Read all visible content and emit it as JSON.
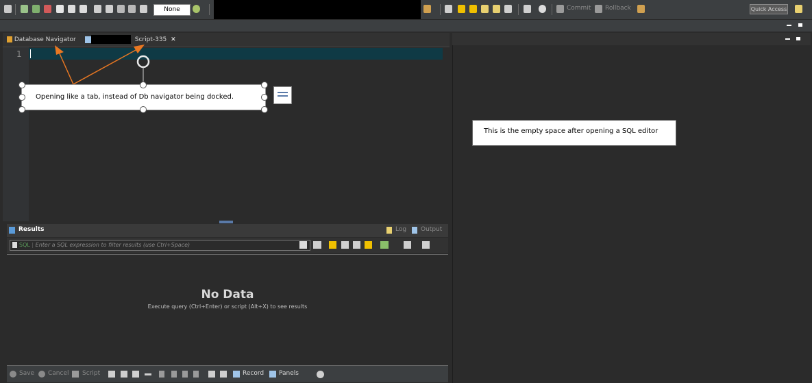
{
  "toolbar": {
    "transaction_mode": "None",
    "commit_label": "Commit",
    "rollback_label": "Rollback",
    "quick_access_label": "Quick Access"
  },
  "editor_tabs": [
    {
      "label": "Database Navigator"
    },
    {
      "label": "Script-335"
    }
  ],
  "editor": {
    "line_number": "1"
  },
  "annotations": {
    "left_note": "Opening like a tab, instead of Db navigator being docked.",
    "right_note": "This is the empty space after opening a SQL editor"
  },
  "results": {
    "tab_label": "Results",
    "log_label": "Log",
    "output_label": "Output",
    "sql_label": "SQL",
    "filter_placeholder": "Enter a SQL expression to filter results (use Ctrl+Space)",
    "no_data_title": "No Data",
    "no_data_hint": "Execute query (Ctrl+Enter) or script (Alt+X) to see results"
  },
  "bottom_bar": {
    "save_label": "Save",
    "cancel_label": "Cancel",
    "script_label": "Script",
    "record_label": "Record",
    "panels_label": "Panels"
  },
  "colors": {
    "background": "#2b2b2b",
    "toolbar": "#3c3f41",
    "current_line": "#0f3a45",
    "arrow": "#e87722",
    "filter_accent": "#f0c000"
  },
  "icons": [
    "db-connect-icon",
    "sql-editor-icon",
    "commit-icon",
    "rollback-icon",
    "filter-icon",
    "refresh-icon",
    "settings-icon",
    "close-icon"
  ]
}
